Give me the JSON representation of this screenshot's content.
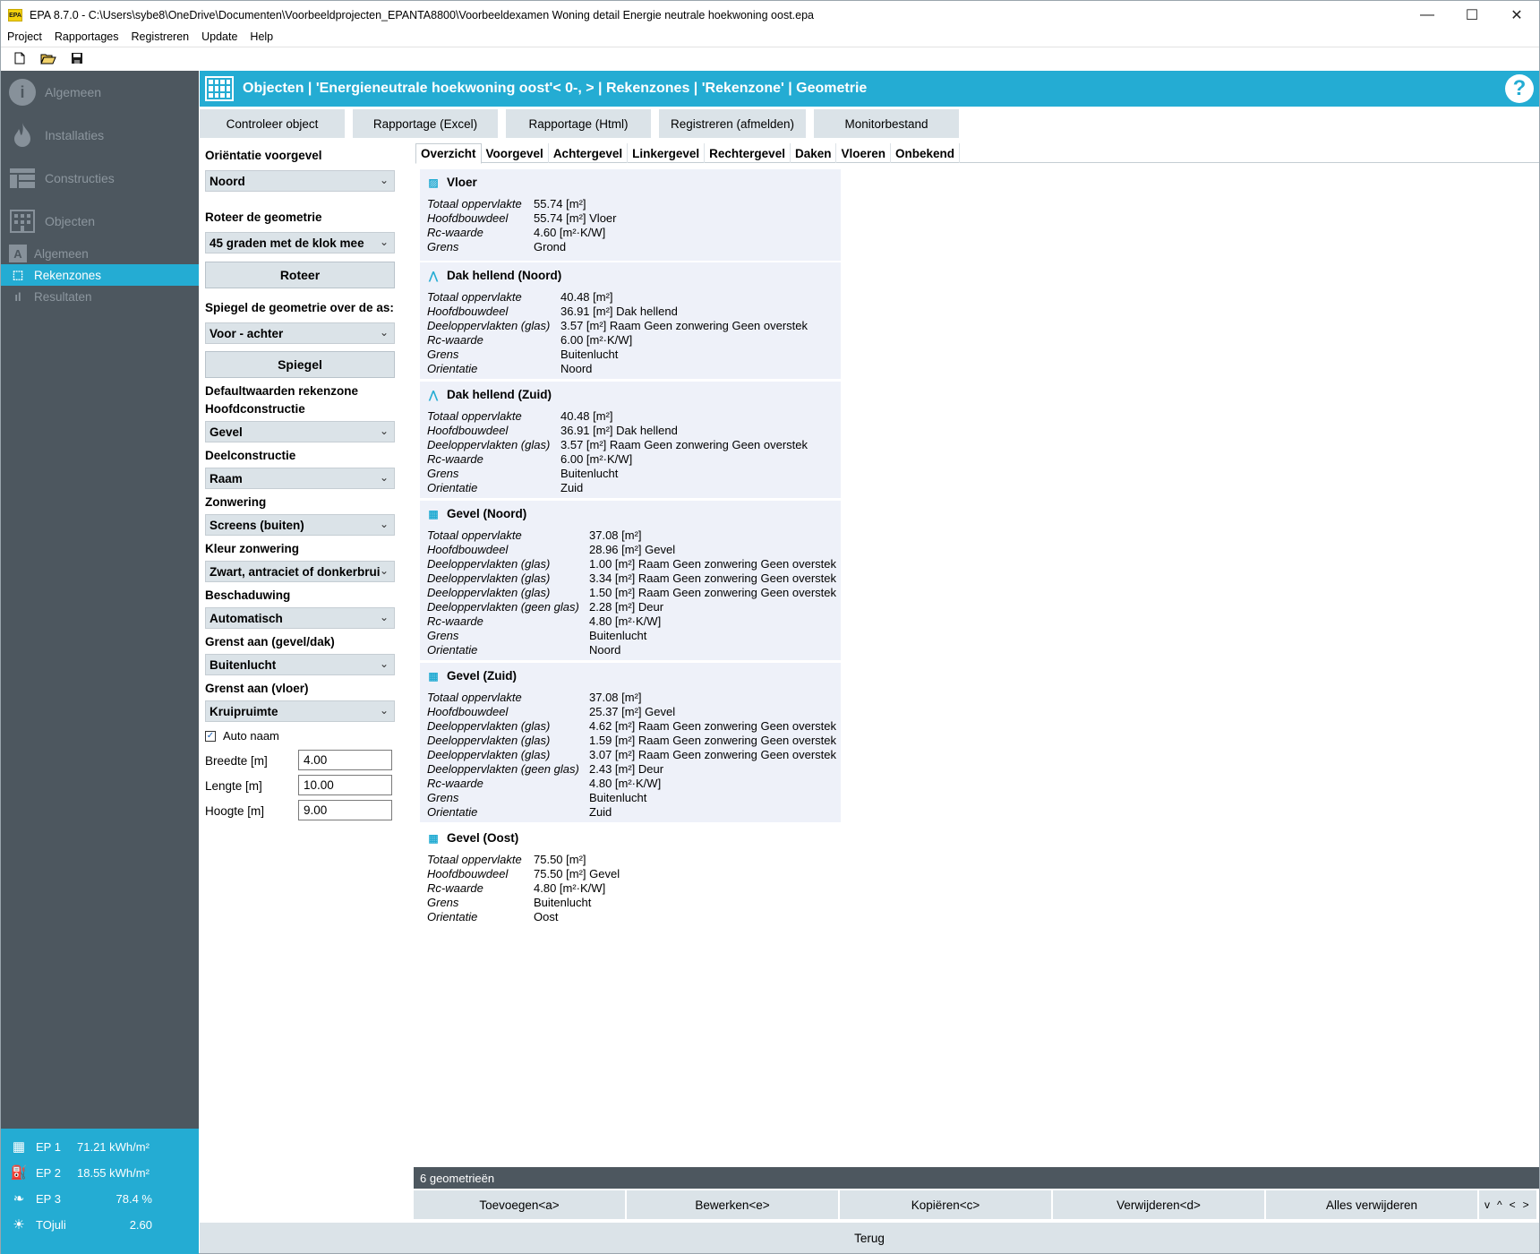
{
  "window": {
    "app_logo": "EPA",
    "title": "EPA 8.7.0 - C:\\Users\\sybe8\\OneDrive\\Documenten\\Voorbeeldprojecten_EPANTA8800\\Voorbeeldexamen Woning detail Energie neutrale hoekwoning oost.epa",
    "minimize": "—",
    "maximize": "☐",
    "close": "✕"
  },
  "menu": [
    "Project",
    "Rapportages",
    "Registreren",
    "Update",
    "Help"
  ],
  "toolbar": {
    "new_icon": "new-file-icon",
    "open_icon": "open-folder-icon",
    "save_icon": "save-disk-icon"
  },
  "sidebar": {
    "main": [
      {
        "label": "Algemeen",
        "icon": "info-icon"
      },
      {
        "label": "Installaties",
        "icon": "flame-icon"
      },
      {
        "label": "Constructies",
        "icon": "constructies-icon"
      },
      {
        "label": "Objecten",
        "icon": "building-icon"
      }
    ],
    "sub": [
      {
        "label": "Algemeen",
        "glyph": "A"
      },
      {
        "label": "Rekenzones",
        "glyph": "⬚",
        "active": true
      },
      {
        "label": "Resultaten",
        "glyph": "ıl"
      }
    ],
    "status": [
      {
        "label": "EP 1",
        "value": "71.21 kWh/m²",
        "icon": "building-icon"
      },
      {
        "label": "EP 2",
        "value": "18.55 kWh/m²",
        "icon": "fuel-pump-icon"
      },
      {
        "label": "EP 3",
        "value": "78.4 %",
        "icon": "leaf-icon"
      },
      {
        "label": "TOjuli",
        "value": "2.60",
        "icon": "sun-icon"
      }
    ]
  },
  "header": {
    "title": "Objecten | 'Energieneutrale hoekwoning oost'< 0-,  > | Rekenzones | 'Rekenzone' | Geometrie",
    "help": "?"
  },
  "actions": [
    "Controleer object",
    "Rapportage (Excel)",
    "Rapportage (Html)",
    "Registreren (afmelden)",
    "Monitorbestand"
  ],
  "form": {
    "orientatie_label": "Oriëntatie voorgevel",
    "orientatie_value": "Noord",
    "roteer_label": "Roteer de geometrie",
    "roteer_value": "45 graden met de klok mee",
    "roteer_button": "Roteer",
    "spiegel_label": "Spiegel de geometrie over de as:",
    "spiegel_value": "Voor - achter",
    "spiegel_button": "Spiegel",
    "default_label": "Defaultwaarden rekenzone",
    "hoofd_label": "Hoofdconstructie",
    "hoofd_value": "Gevel",
    "deel_label": "Deelconstructie",
    "deel_value": "Raam",
    "zonwering_label": "Zonwering",
    "zonwering_value": "Screens (buiten)",
    "kleur_label": "Kleur zonwering",
    "kleur_value": "Zwart, antraciet of donkerbrui",
    "beschaduwing_label": "Beschaduwing",
    "beschaduwing_value": "Automatisch",
    "grens_gevel_label": "Grenst aan (gevel/dak)",
    "grens_gevel_value": "Buitenlucht",
    "grens_vloer_label": "Grenst aan (vloer)",
    "grens_vloer_value": "Kruipruimte",
    "auto_naam_label": "Auto naam",
    "auto_naam_checked": "✓",
    "breedte_label": "Breedte [m]",
    "breedte_value": "4.00",
    "lengte_label": "Lengte [m]",
    "lengte_value": "10.00",
    "hoogte_label": "Hoogte [m]",
    "hoogte_value": "9.00"
  },
  "tabs": [
    "Overzicht",
    "Voorgevel",
    "Achtergevel",
    "Linkergevel",
    "Rechtergevel",
    "Daken",
    "Vloeren",
    "Onbekend"
  ],
  "overview": [
    {
      "title": "Vloer",
      "icon": "floor-icon",
      "glyph": "▨",
      "rows": [
        [
          "Totaal oppervlakte",
          "55.74 [m²]"
        ],
        [
          "Hoofdbouwdeel",
          "55.74 [m²] Vloer"
        ],
        [
          "Rc-waarde",
          "4.60 [m²·K/W]"
        ],
        [
          "Grens",
          "Grond"
        ]
      ]
    },
    {
      "title": "Dak hellend (Noord)",
      "icon": "roof-icon",
      "glyph": "⋀",
      "rows": [
        [
          "Totaal oppervlakte",
          "40.48 [m²]"
        ],
        [
          "Hoofdbouwdeel",
          "36.91 [m²] Dak hellend"
        ],
        [
          "Deeloppervlakten (glas)",
          "3.57 [m²] Raam Geen zonwering Geen overstek"
        ],
        [
          "Rc-waarde",
          "6.00 [m²·K/W]"
        ],
        [
          "Grens",
          "Buitenlucht"
        ],
        [
          "Orientatie",
          "Noord"
        ]
      ]
    },
    {
      "title": "Dak hellend (Zuid)",
      "icon": "roof-icon",
      "glyph": "⋀",
      "rows": [
        [
          "Totaal oppervlakte",
          "40.48 [m²]"
        ],
        [
          "Hoofdbouwdeel",
          "36.91 [m²] Dak hellend"
        ],
        [
          "Deeloppervlakten (glas)",
          "3.57 [m²] Raam Geen zonwering Geen overstek"
        ],
        [
          "Rc-waarde",
          "6.00 [m²·K/W]"
        ],
        [
          "Grens",
          "Buitenlucht"
        ],
        [
          "Orientatie",
          "Zuid"
        ]
      ]
    },
    {
      "title": "Gevel (Noord)",
      "icon": "wall-icon",
      "glyph": "▦",
      "rows": [
        [
          "Totaal oppervlakte",
          "37.08 [m²]"
        ],
        [
          "Hoofdbouwdeel",
          "28.96 [m²] Gevel"
        ],
        [
          "Deeloppervlakten (glas)",
          "1.00 [m²] Raam Geen zonwering Geen overstek"
        ],
        [
          "Deeloppervlakten (glas)",
          "3.34 [m²] Raam Geen zonwering Geen overstek"
        ],
        [
          "Deeloppervlakten (glas)",
          "1.50 [m²] Raam Geen zonwering Geen overstek"
        ],
        [
          "Deeloppervlakten (geen glas)",
          "2.28 [m²] Deur"
        ],
        [
          "Rc-waarde",
          "4.80 [m²·K/W]"
        ],
        [
          "Grens",
          "Buitenlucht"
        ],
        [
          "Orientatie",
          "Noord"
        ]
      ]
    },
    {
      "title": "Gevel (Zuid)",
      "icon": "wall-icon",
      "glyph": "▦",
      "rows": [
        [
          "Totaal oppervlakte",
          "37.08 [m²]"
        ],
        [
          "Hoofdbouwdeel",
          "25.37 [m²] Gevel"
        ],
        [
          "Deeloppervlakten (glas)",
          "4.62 [m²] Raam Geen zonwering Geen overstek"
        ],
        [
          "Deeloppervlakten (glas)",
          "1.59 [m²] Raam Geen zonwering Geen overstek"
        ],
        [
          "Deeloppervlakten (glas)",
          "3.07 [m²] Raam Geen zonwering Geen overstek"
        ],
        [
          "Deeloppervlakten (geen glas)",
          "2.43 [m²] Deur"
        ],
        [
          "Rc-waarde",
          "4.80 [m²·K/W]"
        ],
        [
          "Grens",
          "Buitenlucht"
        ],
        [
          "Orientatie",
          "Zuid"
        ]
      ]
    },
    {
      "title": "Gevel (Oost)",
      "icon": "wall-icon",
      "glyph": "▦",
      "rows": [
        [
          "Totaal oppervlakte",
          "75.50 [m²]"
        ],
        [
          "Hoofdbouwdeel",
          "75.50 [m²] Gevel"
        ],
        [
          "Rc-waarde",
          "4.80 [m²·K/W]"
        ],
        [
          "Grens",
          "Buitenlucht"
        ],
        [
          "Orientatie",
          "Oost"
        ]
      ]
    }
  ],
  "list_count": "6 geometrieën",
  "bottom_buttons": [
    "Toevoegen<a>",
    "Bewerken<e>",
    "Kopiëren<c>",
    "Verwijderen<d>",
    "Alles verwijderen"
  ],
  "nav_arrows": [
    "v",
    "^",
    "<",
    ">"
  ],
  "footer": "Terug"
}
